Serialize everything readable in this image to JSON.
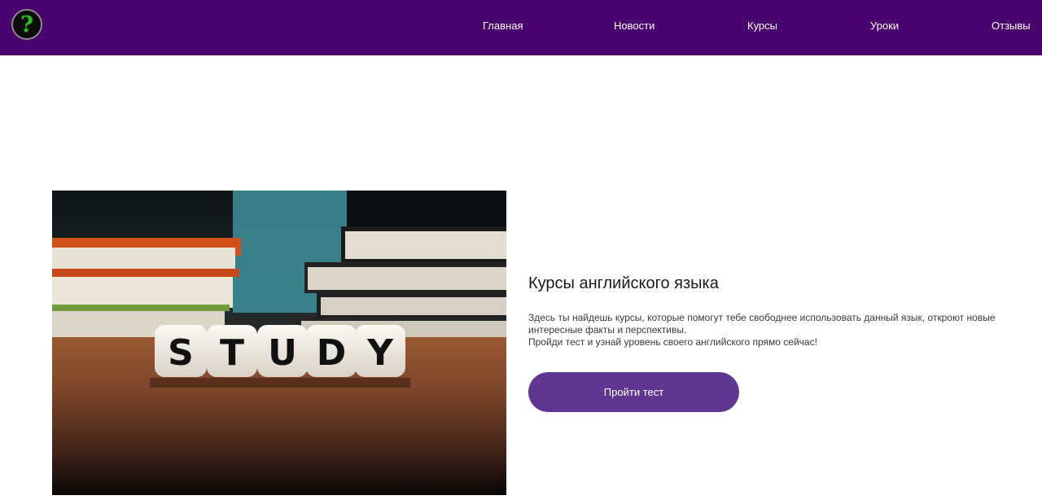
{
  "header": {
    "logo_glyph": "?",
    "nav": [
      "Главная",
      "Новости",
      "Курсы",
      "Уроки",
      "Отзывы"
    ]
  },
  "hero": {
    "image": {
      "icon": "study-dice-books-photo",
      "dice_letters": [
        "S",
        "T",
        "U",
        "D",
        "Y"
      ]
    },
    "heading": "Курсы английского языка",
    "description": [
      "Здесь ты найдешь курсы, которые помогут тебе свободнее использовать данный язык, откроют новые интересные факты и перспективы.",
      "Пройди тест и узнай уровень своего английского прямо сейчас!"
    ],
    "cta_label": "Пройти тест"
  },
  "colors": {
    "header_bg": "#4a0470",
    "button_bg": "#5f3793",
    "logo_question": "#22c322"
  }
}
